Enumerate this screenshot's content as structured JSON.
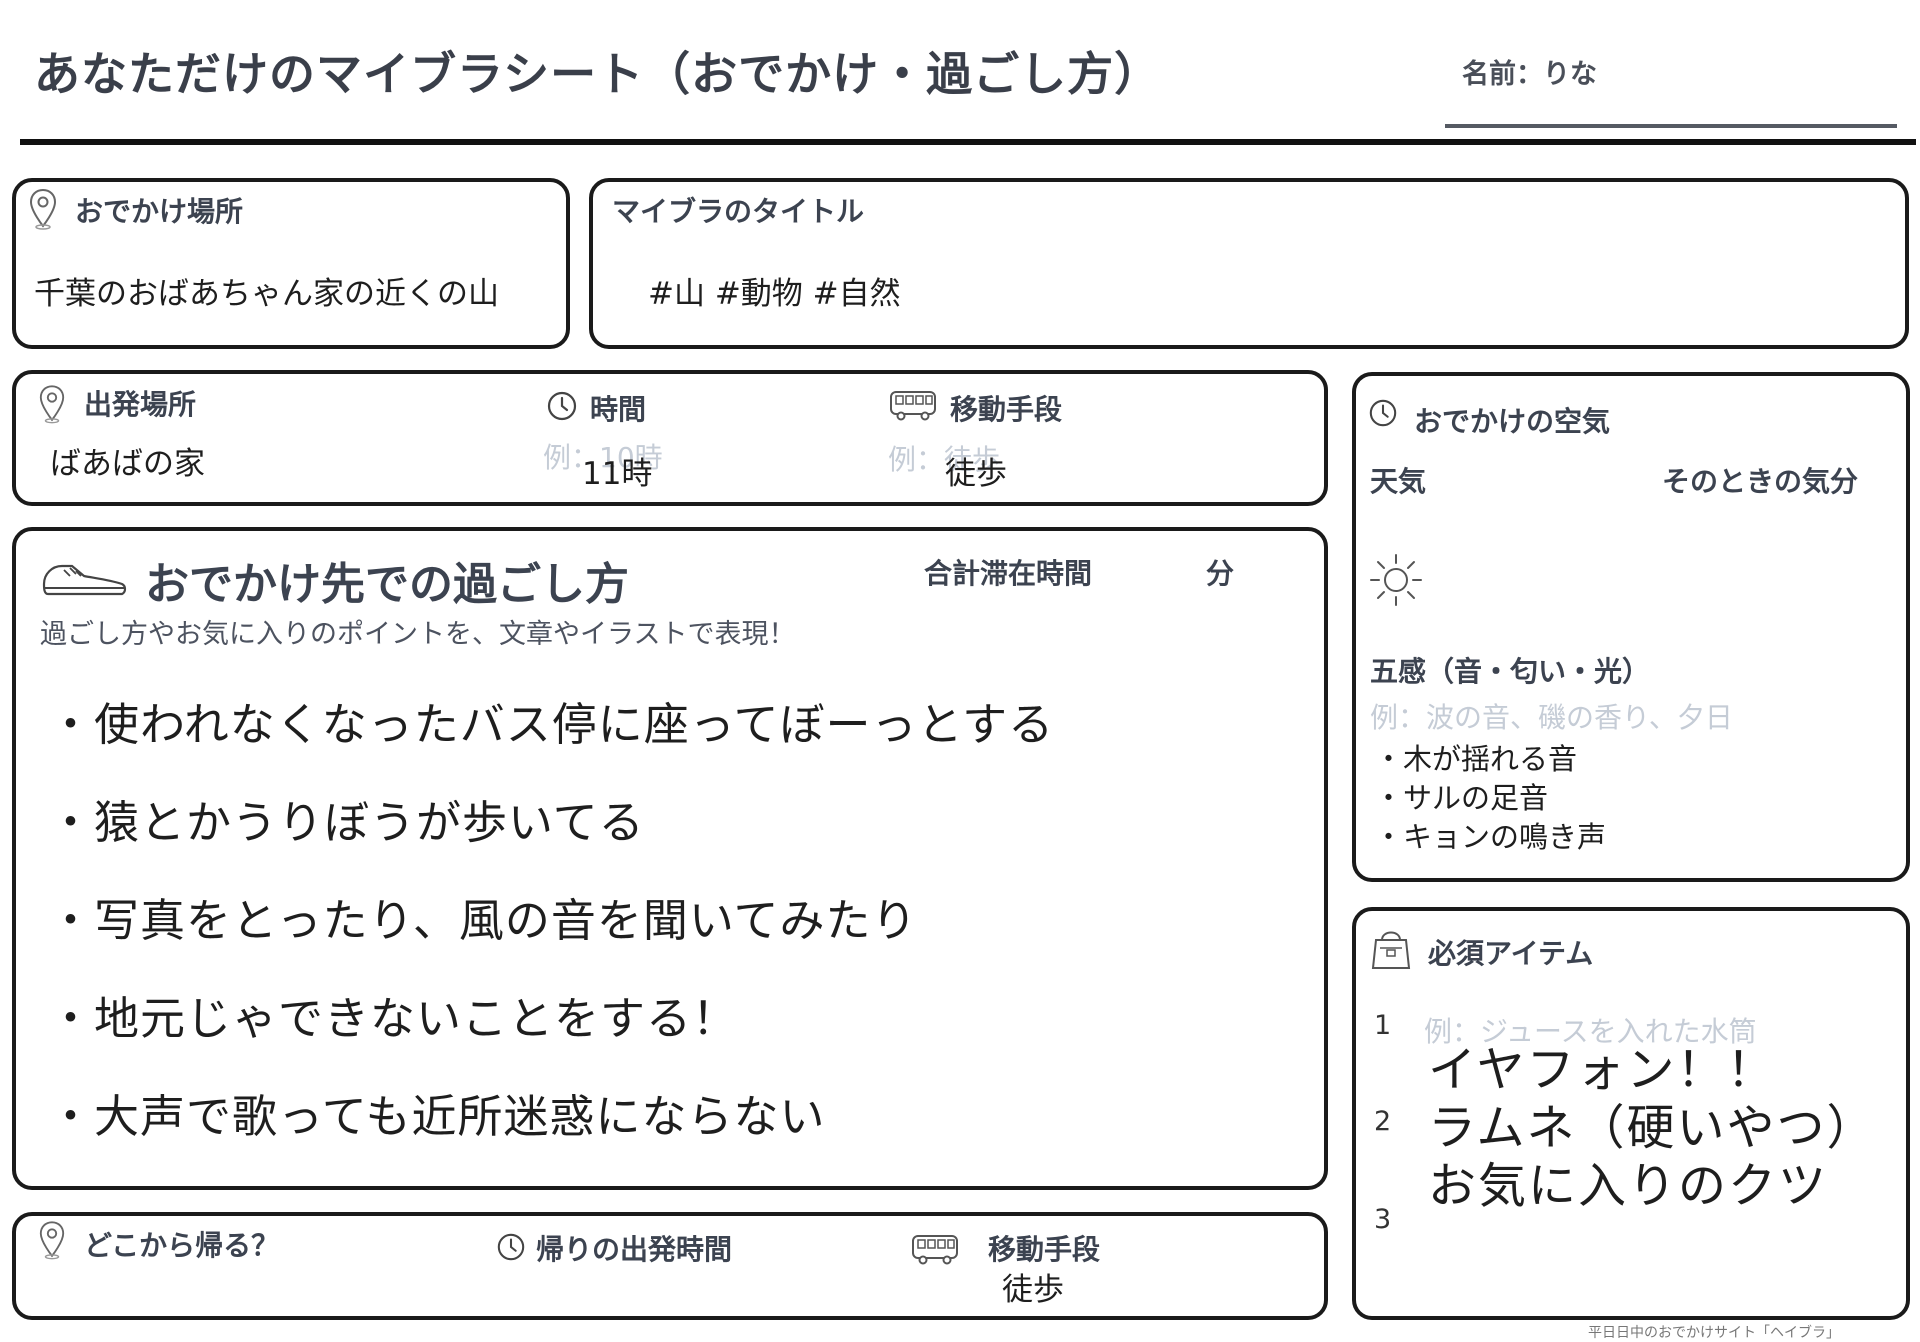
{
  "header": {
    "title": "あなただけのマイブラシート（おでかけ・過ごし方）",
    "name_label": "名前：りな"
  },
  "destination": {
    "label": "おでかけ場所",
    "value": "千葉のおばあちゃん家の近くの山",
    "icon": "map-pin-icon"
  },
  "mybura_title": {
    "label": "マイブラのタイトル",
    "value": "#山 #動物 #自然"
  },
  "departure": {
    "place_label": "出発場所",
    "place_value": "ばあばの家",
    "time_label": "時間",
    "time_placeholder": "例：10時",
    "time_value": "11時",
    "transport_label": "移動手段",
    "transport_placeholder": "例：徒歩",
    "transport_value": "徒歩"
  },
  "spending": {
    "heading": "おでかけ先での過ごし方",
    "total_label": "合計滞在時間",
    "minutes_label": "分",
    "subtitle": "過ごし方やお気に入りのポイントを、文章やイラストで表現！",
    "bullets": [
      "・使われなくなったバス停に座ってぼーっとする",
      "・猿とかうりぼうが歩いてる",
      "・写真をとったり、風の音を聞いてみたり",
      "・地元じゃできないことをする！",
      "・大声で歌っても近所迷惑にならない"
    ]
  },
  "return": {
    "from_label": "どこから帰る？",
    "time_label": "帰りの出発時間",
    "transport_label": "移動手段",
    "transport_value": "徒歩"
  },
  "atmosphere": {
    "label": "おでかけの空気",
    "weather_label": "天気",
    "mood_label": "そのときの気分",
    "weather_icon": "sun-icon",
    "senses_label": "五感（音・匂い・光）",
    "senses_placeholder": "例：波の音、磯の香り、夕日",
    "senses": [
      "・木が揺れる音",
      "・サルの足音",
      "・キョンの鳴き声"
    ]
  },
  "items": {
    "label": "必須アイテム",
    "placeholder": "例：ジュースを入れた水筒",
    "numbers": [
      "1",
      "2",
      "3"
    ],
    "values": [
      "イヤフォン！！",
      "ラムネ（硬いやつ）",
      "お気に入りのクツ"
    ]
  },
  "footer": "平日日中のおでかけサイト「ヘイブラ」"
}
